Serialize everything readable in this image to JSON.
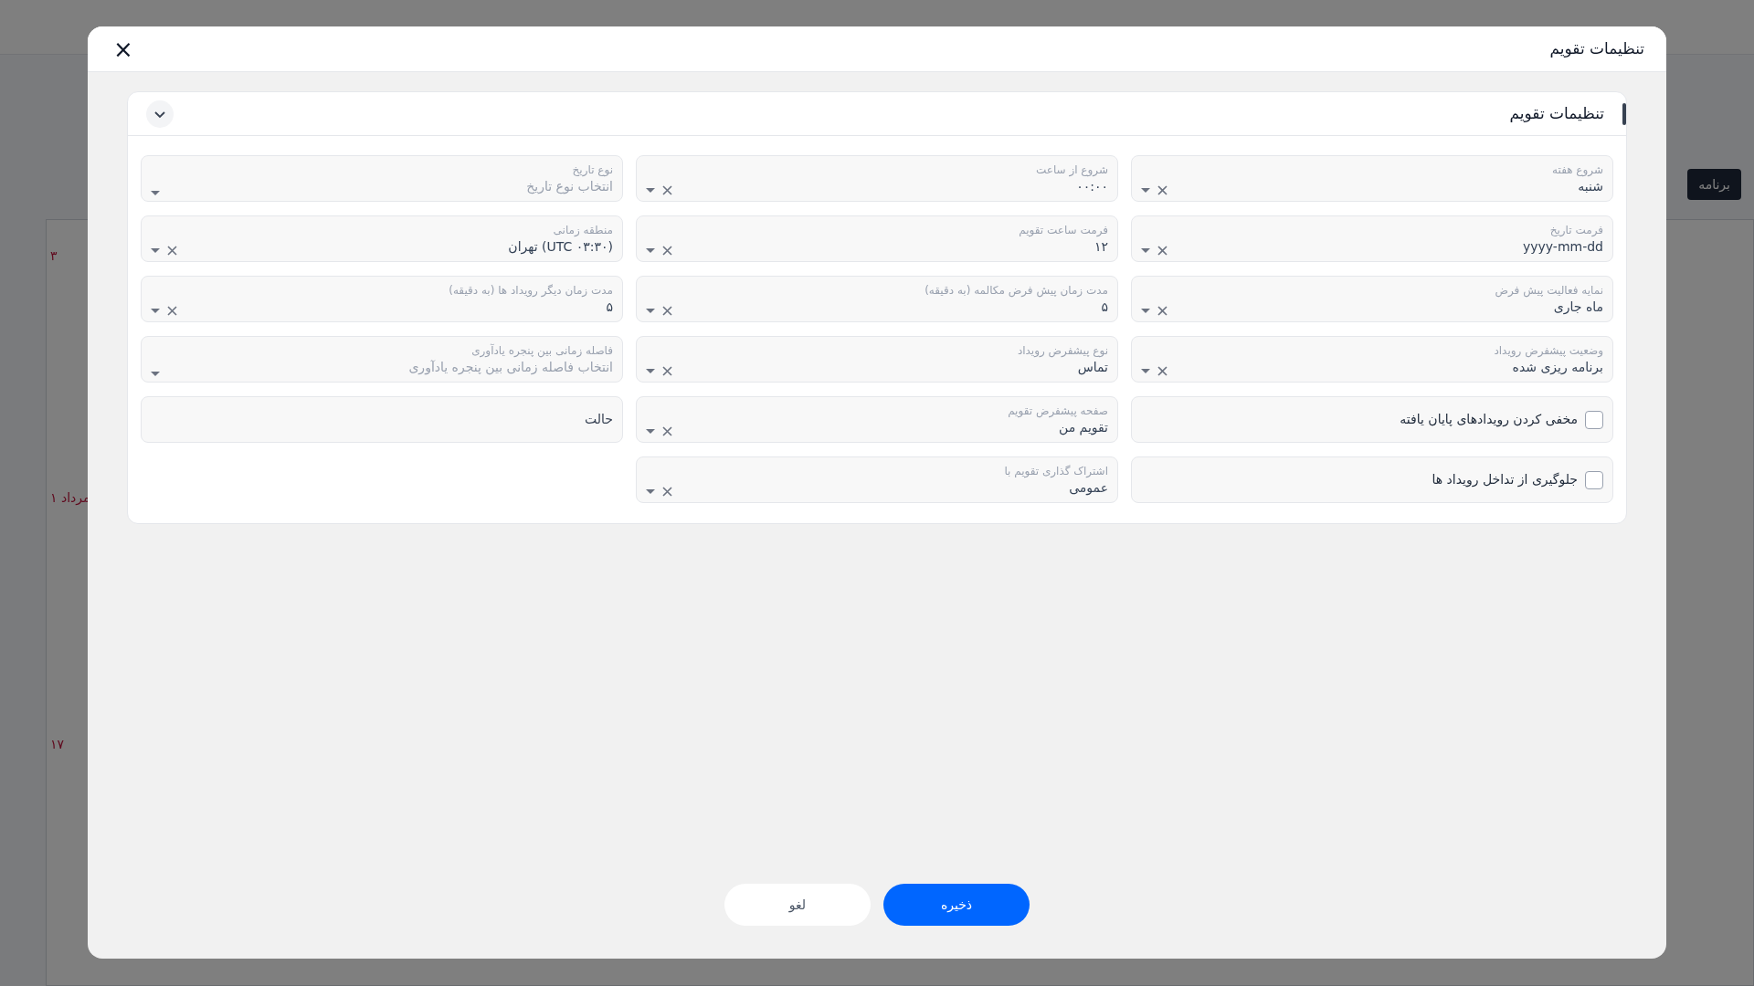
{
  "background": {
    "side_button": "برنامه",
    "days": [
      "۳",
      "۱ مرداد",
      "۱۷"
    ]
  },
  "dialog": {
    "title": "تنظیمات تقویم",
    "close": "×"
  },
  "card": {
    "title": "تنظیمات تقویم",
    "expanded": true
  },
  "fields": [
    {
      "kind": "select",
      "label": "شروع هفته",
      "value": "شنبه",
      "clearable": true
    },
    {
      "kind": "select",
      "label": "شروع از ساعت",
      "value": "۰۰:۰۰",
      "clearable": true
    },
    {
      "kind": "select",
      "label": "نوع تاریخ",
      "placeholder": "انتخاب نوع تاریخ",
      "clearable": false
    },
    {
      "kind": "select",
      "label": "فرمت تاریخ",
      "value": "yyyy-mm-dd",
      "clearable": true
    },
    {
      "kind": "select",
      "label": "فرمت ساعت تقویم",
      "value": "۱۲",
      "clearable": true
    },
    {
      "kind": "select",
      "label": "منطقه زمانی",
      "value": "(UTC ۰۳:۳۰) تهران",
      "clearable": true
    },
    {
      "kind": "select",
      "label": "نمایه فعالیت پیش فرض",
      "value": "ماه جاری",
      "clearable": true
    },
    {
      "kind": "select",
      "label": "مدت زمان پیش فرض مکالمه (به دقیقه)",
      "value": "۵",
      "clearable": true
    },
    {
      "kind": "select",
      "label": "مدت زمان دیگر رویداد ها (به دقیقه)",
      "value": "۵",
      "clearable": true
    },
    {
      "kind": "select",
      "label": "وضعیت پیشفرض رویداد",
      "value": "برنامه ریزی شده",
      "clearable": true
    },
    {
      "kind": "select",
      "label": "نوع پیشفرض رویداد",
      "value": "تماس",
      "clearable": true
    },
    {
      "kind": "select",
      "label": "فاصله زمانی بین پنجره یادآوری",
      "placeholder": "انتخاب فاصله زمانی بین پنجره یادآوری",
      "clearable": false
    },
    {
      "kind": "checkbox",
      "label": "مخفی کردن رویدادهای پایان یافته",
      "checked": false
    },
    {
      "kind": "select",
      "label": "صفحه پیشفرض تقویم",
      "value": "تقویم من",
      "clearable": true
    },
    {
      "kind": "text",
      "label": "حالت"
    },
    {
      "kind": "checkbox",
      "label": "جلوگیری از تداخل رویداد ها",
      "checked": false
    },
    {
      "kind": "select",
      "label": "اشتراک گذاری تقویم با",
      "value": "عمومی",
      "clearable": true
    }
  ],
  "buttons": {
    "save": "ذخیره",
    "cancel": "لغو"
  }
}
